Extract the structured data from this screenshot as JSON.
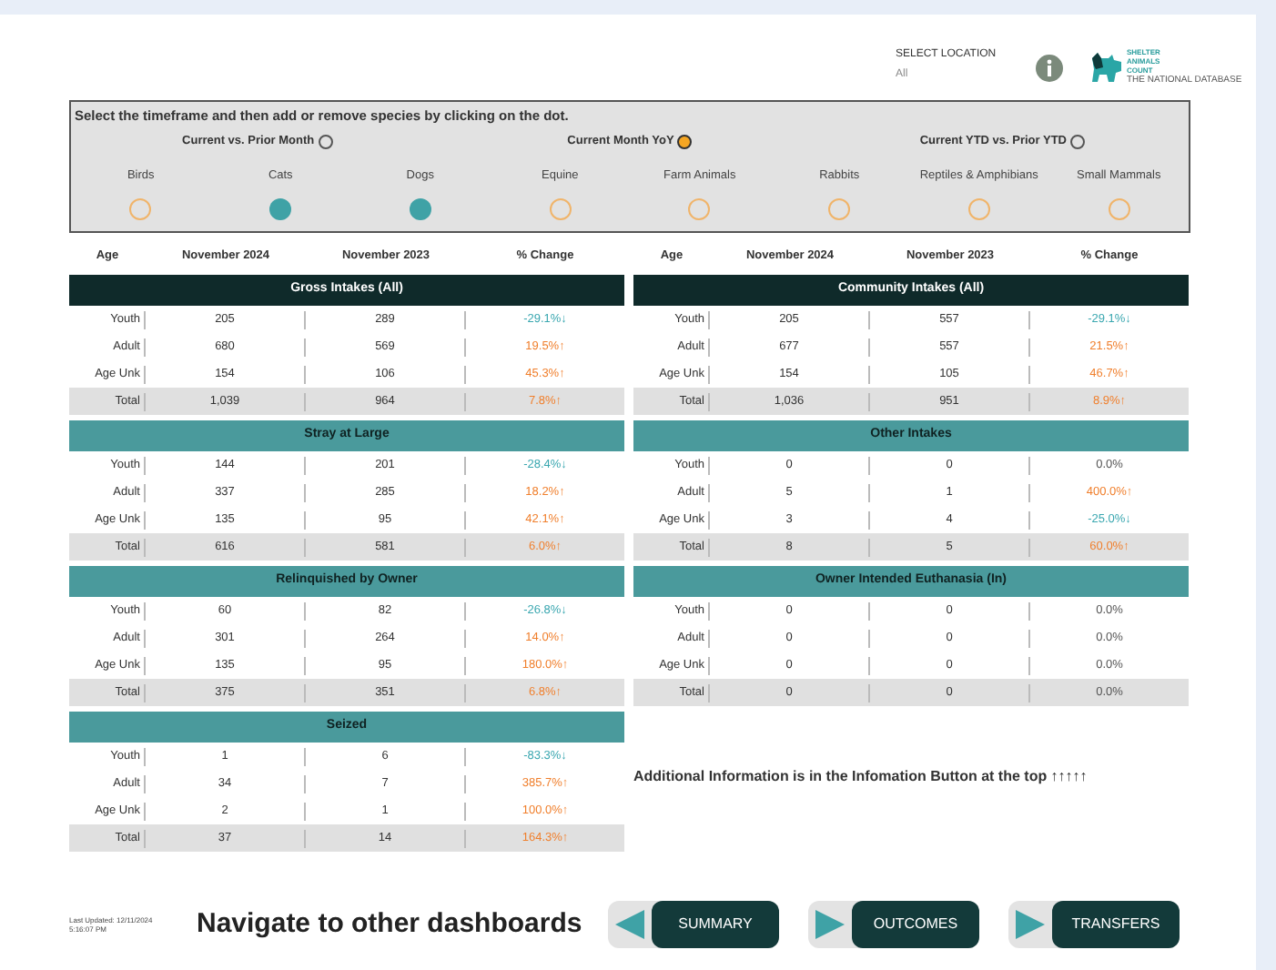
{
  "location": {
    "label": "SELECT LOCATION",
    "value": "All"
  },
  "logo": {
    "lines": [
      "SHELTER",
      "ANIMALS",
      "COUNT"
    ],
    "tagline": "THE NATIONAL DATABASE"
  },
  "filters": {
    "instruction": "Select the timeframe and then add or remove species by clicking on the dot.",
    "timeframes": [
      {
        "label": "Current vs. Prior Month",
        "selected": false
      },
      {
        "label": "Current Month YoY",
        "selected": true
      },
      {
        "label": "Current YTD vs. Prior YTD",
        "selected": false
      }
    ],
    "species": [
      {
        "label": "Birds",
        "selected": false
      },
      {
        "label": "Cats",
        "selected": true
      },
      {
        "label": "Dogs",
        "selected": true
      },
      {
        "label": "Equine",
        "selected": false
      },
      {
        "label": "Farm Animals",
        "selected": false
      },
      {
        "label": "Rabbits",
        "selected": false
      },
      {
        "label": "Reptiles & Amphibians",
        "selected": false
      },
      {
        "label": "Small Mammals",
        "selected": false
      }
    ]
  },
  "columns": [
    [
      "Age",
      "November 2024",
      "November 2023",
      "% Change"
    ],
    [
      "Age",
      "November 2024",
      "November 2023",
      "% Change"
    ]
  ],
  "tables": [
    [
      {
        "title": "Gross Intakes (All)",
        "kind": "summary",
        "rows": [
          {
            "age": "Youth",
            "current": "205",
            "prior": "289",
            "change": "-29.1%↓",
            "color": "#3aa7b0",
            "total": false
          },
          {
            "age": "Adult",
            "current": "680",
            "prior": "569",
            "change": "19.5%↑",
            "color": "#f07f2c",
            "total": false
          },
          {
            "age": "Age Unk",
            "current": "154",
            "prior": "106",
            "change": "45.3%↑",
            "color": "#f07f2c",
            "total": false
          },
          {
            "age": "Total",
            "current": "1,039",
            "prior": "964",
            "change": "7.8%↑",
            "color": "#f07f2c",
            "total": true
          }
        ]
      },
      {
        "title": "Stray at Large",
        "kind": "section",
        "rows": [
          {
            "age": "Youth",
            "current": "144",
            "prior": "201",
            "change": "-28.4%↓",
            "color": "#3aa7b0",
            "total": false
          },
          {
            "age": "Adult",
            "current": "337",
            "prior": "285",
            "change": "18.2%↑",
            "color": "#f07f2c",
            "total": false
          },
          {
            "age": "Age Unk",
            "current": "135",
            "prior": "95",
            "change": "42.1%↑",
            "color": "#f07f2c",
            "total": false
          },
          {
            "age": "Total",
            "current": "616",
            "prior": "581",
            "change": "6.0%↑",
            "color": "#f07f2c",
            "total": true
          }
        ]
      },
      {
        "title": "Relinquished by Owner",
        "kind": "section",
        "rows": [
          {
            "age": "Youth",
            "current": "60",
            "prior": "82",
            "change": "-26.8%↓",
            "color": "#3aa7b0",
            "total": false
          },
          {
            "age": "Adult",
            "current": "301",
            "prior": "264",
            "change": "14.0%↑",
            "color": "#f07f2c",
            "total": false
          },
          {
            "age": "Age Unk",
            "current": "135",
            "prior": "95",
            "change": "180.0%↑",
            "color": "#f07f2c",
            "total": false
          },
          {
            "age": "Total",
            "current": "375",
            "prior": "351",
            "change": "6.8%↑",
            "color": "#f07f2c",
            "total": true
          }
        ]
      },
      {
        "title": "Seized",
        "kind": "section",
        "rows": [
          {
            "age": "Youth",
            "current": "1",
            "prior": "6",
            "change": "-83.3%↓",
            "color": "#3aa7b0",
            "total": false
          },
          {
            "age": "Adult",
            "current": "34",
            "prior": "7",
            "change": "385.7%↑",
            "color": "#f07f2c",
            "total": false
          },
          {
            "age": "Age Unk",
            "current": "2",
            "prior": "1",
            "change": "100.0%↑",
            "color": "#f07f2c",
            "total": false
          },
          {
            "age": "Total",
            "current": "37",
            "prior": "14",
            "change": "164.3%↑",
            "color": "#f07f2c",
            "total": true
          }
        ]
      }
    ],
    [
      {
        "title": "Community Intakes (All)",
        "kind": "summary",
        "rows": [
          {
            "age": "Youth",
            "current": "205",
            "prior": "557",
            "change": "-29.1%↓",
            "color": "#3aa7b0",
            "total": false
          },
          {
            "age": "Adult",
            "current": "677",
            "prior": "557",
            "change": "21.5%↑",
            "color": "#f07f2c",
            "total": false
          },
          {
            "age": "Age Unk",
            "current": "154",
            "prior": "105",
            "change": "46.7%↑",
            "color": "#f07f2c",
            "total": false
          },
          {
            "age": "Total",
            "current": "1,036",
            "prior": "951",
            "change": "8.9%↑",
            "color": "#f07f2c",
            "total": true
          }
        ]
      },
      {
        "title": "Other Intakes",
        "kind": "section",
        "rows": [
          {
            "age": "Youth",
            "current": "0",
            "prior": "0",
            "change": "0.0%",
            "color": "#555555",
            "total": false
          },
          {
            "age": "Adult",
            "current": "5",
            "prior": "1",
            "change": "400.0%↑",
            "color": "#f07f2c",
            "total": false
          },
          {
            "age": "Age Unk",
            "current": "3",
            "prior": "4",
            "change": "-25.0%↓",
            "color": "#3aa7b0",
            "total": false
          },
          {
            "age": "Total",
            "current": "8",
            "prior": "5",
            "change": "60.0%↑",
            "color": "#f07f2c",
            "total": true
          }
        ]
      },
      {
        "title": "Owner Intended Euthanasia (In)",
        "kind": "section",
        "rows": [
          {
            "age": "Youth",
            "current": "0",
            "prior": "0",
            "change": "0.0%",
            "color": "#555555",
            "total": false
          },
          {
            "age": "Adult",
            "current": "0",
            "prior": "0",
            "change": "0.0%",
            "color": "#555555",
            "total": false
          },
          {
            "age": "Age Unk",
            "current": "0",
            "prior": "0",
            "change": "0.0%",
            "color": "#555555",
            "total": false
          },
          {
            "age": "Total",
            "current": "0",
            "prior": "0",
            "change": "0.0%",
            "color": "#555555",
            "total": true
          }
        ]
      }
    ]
  ],
  "note": "Additional Information is in the Infomation Button at the top ↑↑↑↑↑",
  "footer": {
    "updated": [
      "Last Updated: 12/11/2024",
      "5:16:07 PM"
    ],
    "heading": "Navigate to other dashboards",
    "buttons": [
      {
        "label": "SUMMARY",
        "kind": "back"
      },
      {
        "label": "OUTCOMES",
        "kind": "forward"
      },
      {
        "label": "TRANSFERS",
        "kind": "forward"
      }
    ]
  }
}
